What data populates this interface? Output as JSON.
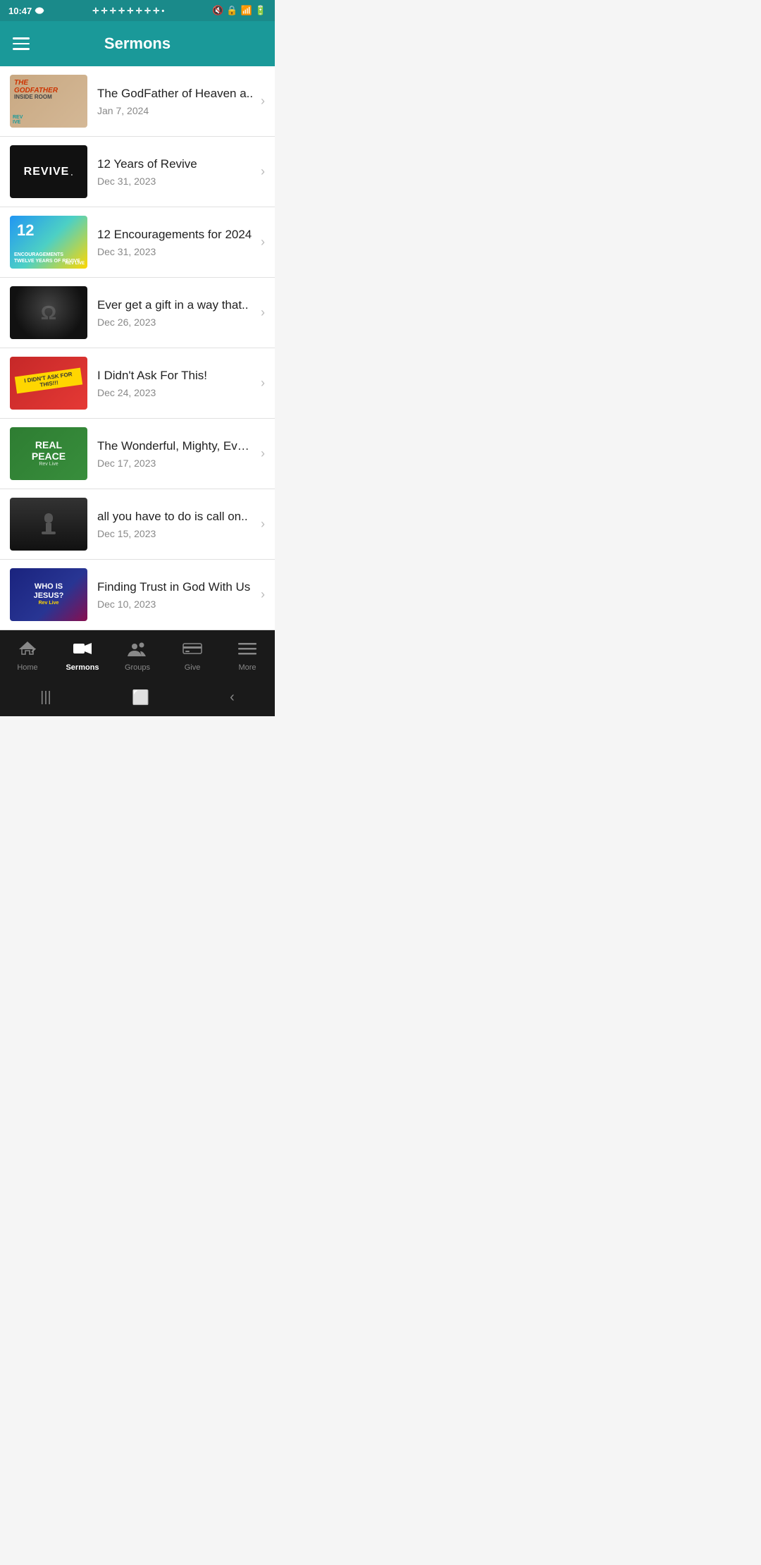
{
  "statusBar": {
    "time": "10:47",
    "icons": "✛ ✛ ✛ ✛ ✛ ✛ ✛ ✛ •"
  },
  "header": {
    "title": "Sermons",
    "menuLabel": "Menu"
  },
  "sermons": [
    {
      "id": 1,
      "title": "The GodFather of Heaven a..",
      "date": "Jan 7, 2024",
      "thumbType": "godfather"
    },
    {
      "id": 2,
      "title": "12 Years of Revive",
      "date": "Dec 31, 2023",
      "thumbType": "revive"
    },
    {
      "id": 3,
      "title": "12 Encouragements for 2024",
      "date": "Dec 31, 2023",
      "thumbType": "encouragements"
    },
    {
      "id": 4,
      "title": "Ever get a gift in a way that..",
      "date": "Dec 26, 2023",
      "thumbType": "dark-stage"
    },
    {
      "id": 5,
      "title": "I Didn't Ask For This!",
      "date": "Dec 24, 2023",
      "thumbType": "didnt-ask"
    },
    {
      "id": 6,
      "title": "The Wonderful, Mighty, Everl..",
      "date": "Dec 17, 2023",
      "thumbType": "real-peace"
    },
    {
      "id": 7,
      "title": "all you have to do is call on..",
      "date": "Dec 15, 2023",
      "thumbType": "dark-call"
    },
    {
      "id": 8,
      "title": "Finding Trust in God With Us",
      "date": "Dec 10, 2023",
      "thumbType": "who-is-jesus"
    }
  ],
  "bottomNav": {
    "items": [
      {
        "id": "home",
        "label": "Home",
        "icon": "↩",
        "active": false
      },
      {
        "id": "sermons",
        "label": "Sermons",
        "icon": "🎥",
        "active": true
      },
      {
        "id": "groups",
        "label": "Groups",
        "icon": "👥",
        "active": false
      },
      {
        "id": "give",
        "label": "Give",
        "icon": "💳",
        "active": false
      },
      {
        "id": "more",
        "label": "More",
        "icon": "☰",
        "active": false
      }
    ]
  },
  "systemNav": {
    "back": "‹",
    "home": "⬜",
    "recents": "|||"
  }
}
